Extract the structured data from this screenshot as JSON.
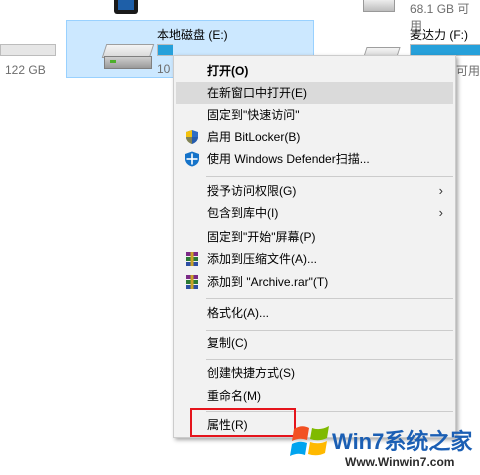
{
  "explorer": {
    "left_drive_size": "122 GB",
    "top_right_drive_size": "68.1 GB 可用",
    "selected_drive": {
      "name": "本地磁盘 (E:)",
      "size_prefix": "10",
      "used_fraction": 0.1
    },
    "right_drive": {
      "name": "麦达力 (F:)",
      "size_suffix": "可用"
    }
  },
  "context_menu": {
    "items": [
      {
        "label": "打开(O)"
      },
      {
        "label": "在新窗口中打开(E)"
      },
      {
        "label": "固定到\"快速访问\""
      },
      {
        "label": "启用 BitLocker(B)",
        "icon": "shield-uac-icon"
      },
      {
        "label": "使用 Windows Defender扫描...",
        "icon": "windows-defender-icon"
      },
      {
        "label": "授予访问权限(G)"
      },
      {
        "label": "包含到库中(I)"
      },
      {
        "label": "固定到\"开始\"屏幕(P)"
      },
      {
        "label": "添加到压缩文件(A)...",
        "icon": "winrar-icon"
      },
      {
        "label": "添加到 \"Archive.rar\"(T)",
        "icon": "winrar-icon"
      },
      {
        "label": "格式化(A)..."
      },
      {
        "label": "复制(C)"
      },
      {
        "label": "创建快捷方式(S)"
      },
      {
        "label": "重命名(M)"
      },
      {
        "label": "属性(R)"
      }
    ],
    "hovered_item": "在新窗口中打开(E)",
    "submenu_arrow": "›"
  },
  "watermark": {
    "title": "Win7系统之家",
    "url": "Www.Winwin7.com"
  },
  "colors": {
    "selection": "#cce8ff",
    "menu_bg": "#f2f2f2",
    "highlight_border": "#e5141c",
    "bar_fill": "#26a0da"
  }
}
